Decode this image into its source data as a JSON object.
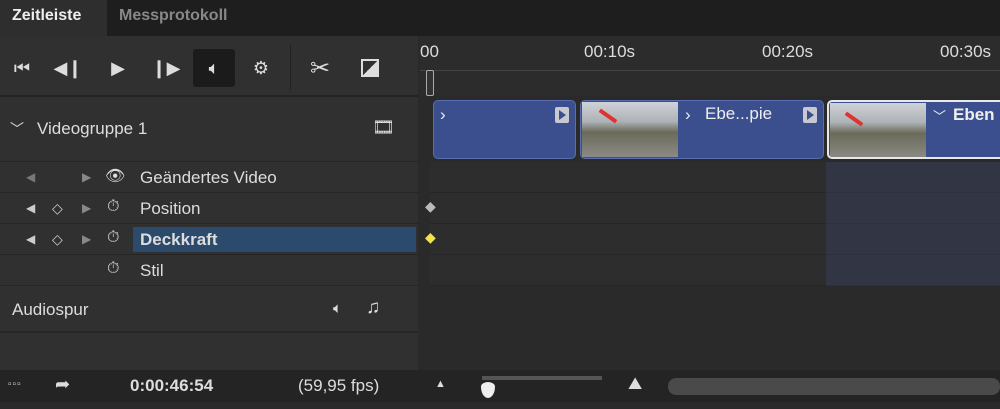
{
  "tabs": [
    {
      "label": "Zeitleiste",
      "active": true
    },
    {
      "label": "Messprotokoll",
      "active": false
    }
  ],
  "toolbar": {
    "icons": [
      "skip-to-start-icon",
      "previous-frame-icon",
      "play-icon",
      "next-frame-icon",
      "audio-icon",
      "gear-icon",
      "scissors-icon",
      "transition-icon"
    ]
  },
  "ruler": {
    "ticks": [
      "00",
      "00:10s",
      "00:20s",
      "00:30s"
    ]
  },
  "tracks": {
    "video_group": "Videogruppe 1",
    "properties": [
      {
        "label": "Geändertes Video",
        "icon": "eye-icon"
      },
      {
        "label": "Position",
        "icon": "stopwatch-icon"
      },
      {
        "label": "Deckkraft",
        "icon": "stopwatch-icon",
        "selected": true
      },
      {
        "label": "Stil",
        "icon": "stopwatch-icon"
      }
    ],
    "audio": "Audiospur"
  },
  "clips": [
    {
      "label": ""
    },
    {
      "label": "Ebe...pie"
    },
    {
      "label": "Eben",
      "selected": true
    }
  ],
  "status": {
    "timecode": "0:00:46:54",
    "fps": "(59,95 fps)"
  },
  "colors": {
    "clip": "#3b4f8e",
    "keyframe_selected": "#f5e14a",
    "selection": "#2c4a6b"
  }
}
